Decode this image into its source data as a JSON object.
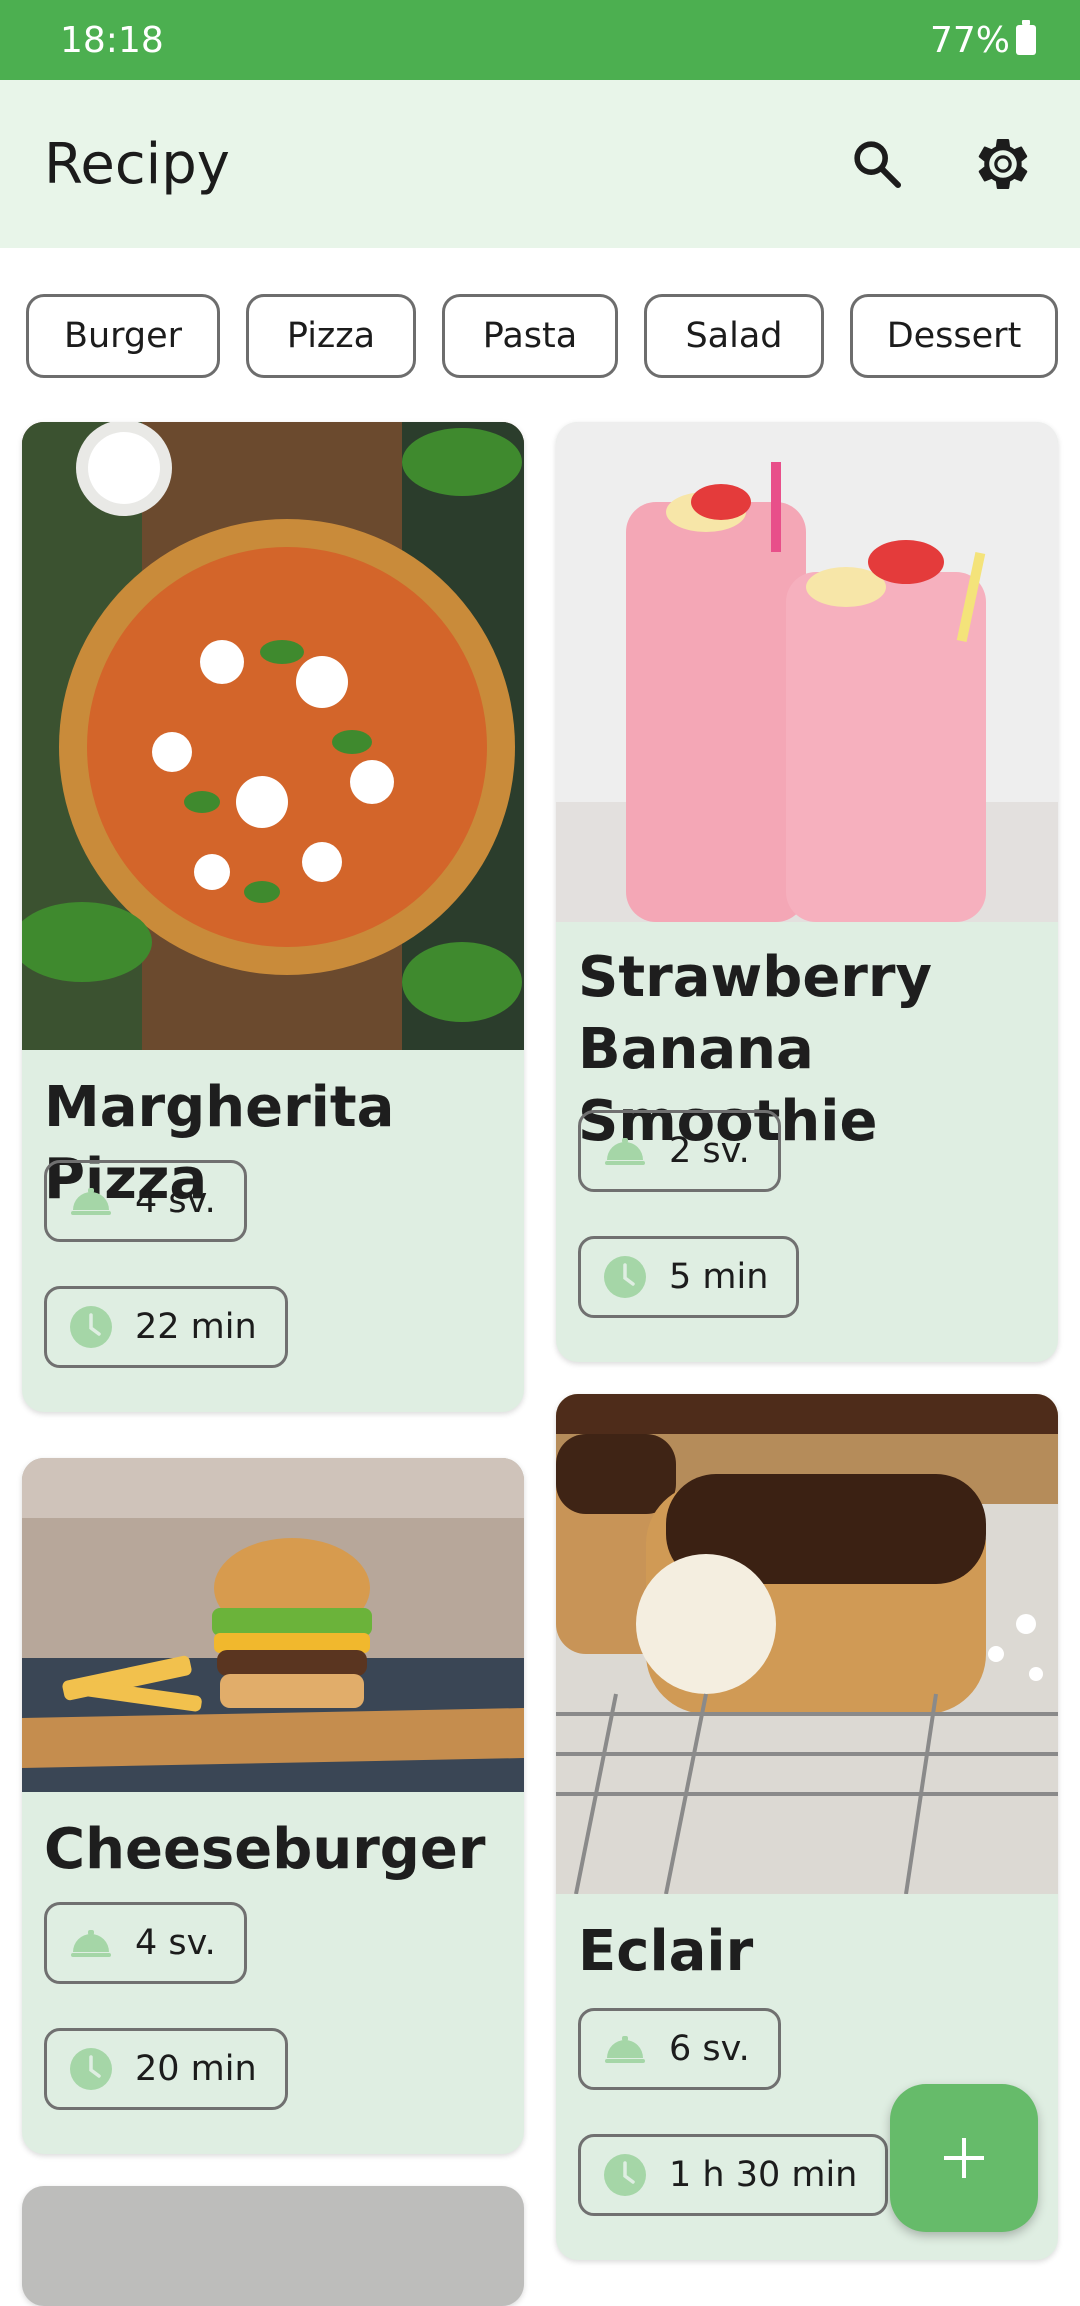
{
  "status": {
    "time": "18:18",
    "battery": "77%"
  },
  "app_bar": {
    "title": "Recipy",
    "search_icon": "search-icon",
    "settings_icon": "gear-icon"
  },
  "filters": [
    "Burger",
    "Pizza",
    "Pasta",
    "Salad",
    "Dessert"
  ],
  "recipes": [
    {
      "title": "Margherita Pizza",
      "servings": "4 sv.",
      "time": "22 min"
    },
    {
      "title_line1": "Strawberry",
      "title_line2": "Banana Smoothie",
      "servings": "2 sv.",
      "time": "5 min"
    },
    {
      "title": "Cheeseburger",
      "servings": "4 sv.",
      "time": "20 min"
    },
    {
      "title": "Eclair",
      "servings": "6 sv.",
      "time": "1 h 30 min"
    }
  ],
  "icons": {
    "servings": "serving-dish-icon",
    "time": "clock-icon",
    "fab": "plus-icon"
  },
  "colors": {
    "primary": "#4caf50",
    "card_bg": "#dfeee2",
    "app_bar_bg": "#e8f5e9",
    "fab": "#66bb6a",
    "icon_green": "#a5d6a7"
  }
}
